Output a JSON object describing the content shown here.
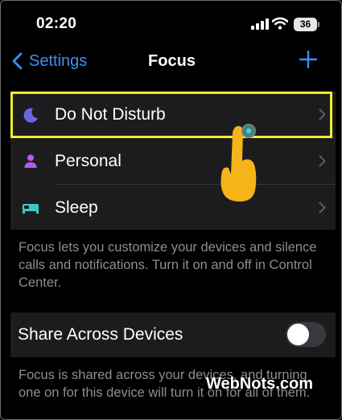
{
  "status_bar": {
    "time": "02:20",
    "battery_level": "36"
  },
  "nav": {
    "back_label": "Settings",
    "title": "Focus"
  },
  "focus_modes": [
    {
      "label": "Do Not Disturb",
      "icon": "moon-icon",
      "color": "#6b66e6"
    },
    {
      "label": "Personal",
      "icon": "person-icon",
      "color": "#b25ce8"
    },
    {
      "label": "Sleep",
      "icon": "bed-icon",
      "color": "#3fc8c4"
    }
  ],
  "caption_focus": "Focus lets you customize your devices and silence calls and notifications. Turn it on and off in Control Center.",
  "share": {
    "label": "Share Across Devices",
    "enabled": false
  },
  "caption_share": "Focus is shared across your devices, and turning one on for this device will turn it on for all of them.",
  "watermark": "WebNots.com",
  "colors": {
    "accent": "#3a8ff7",
    "highlight": "#f2ea34",
    "pointer": "#f4b41a"
  }
}
